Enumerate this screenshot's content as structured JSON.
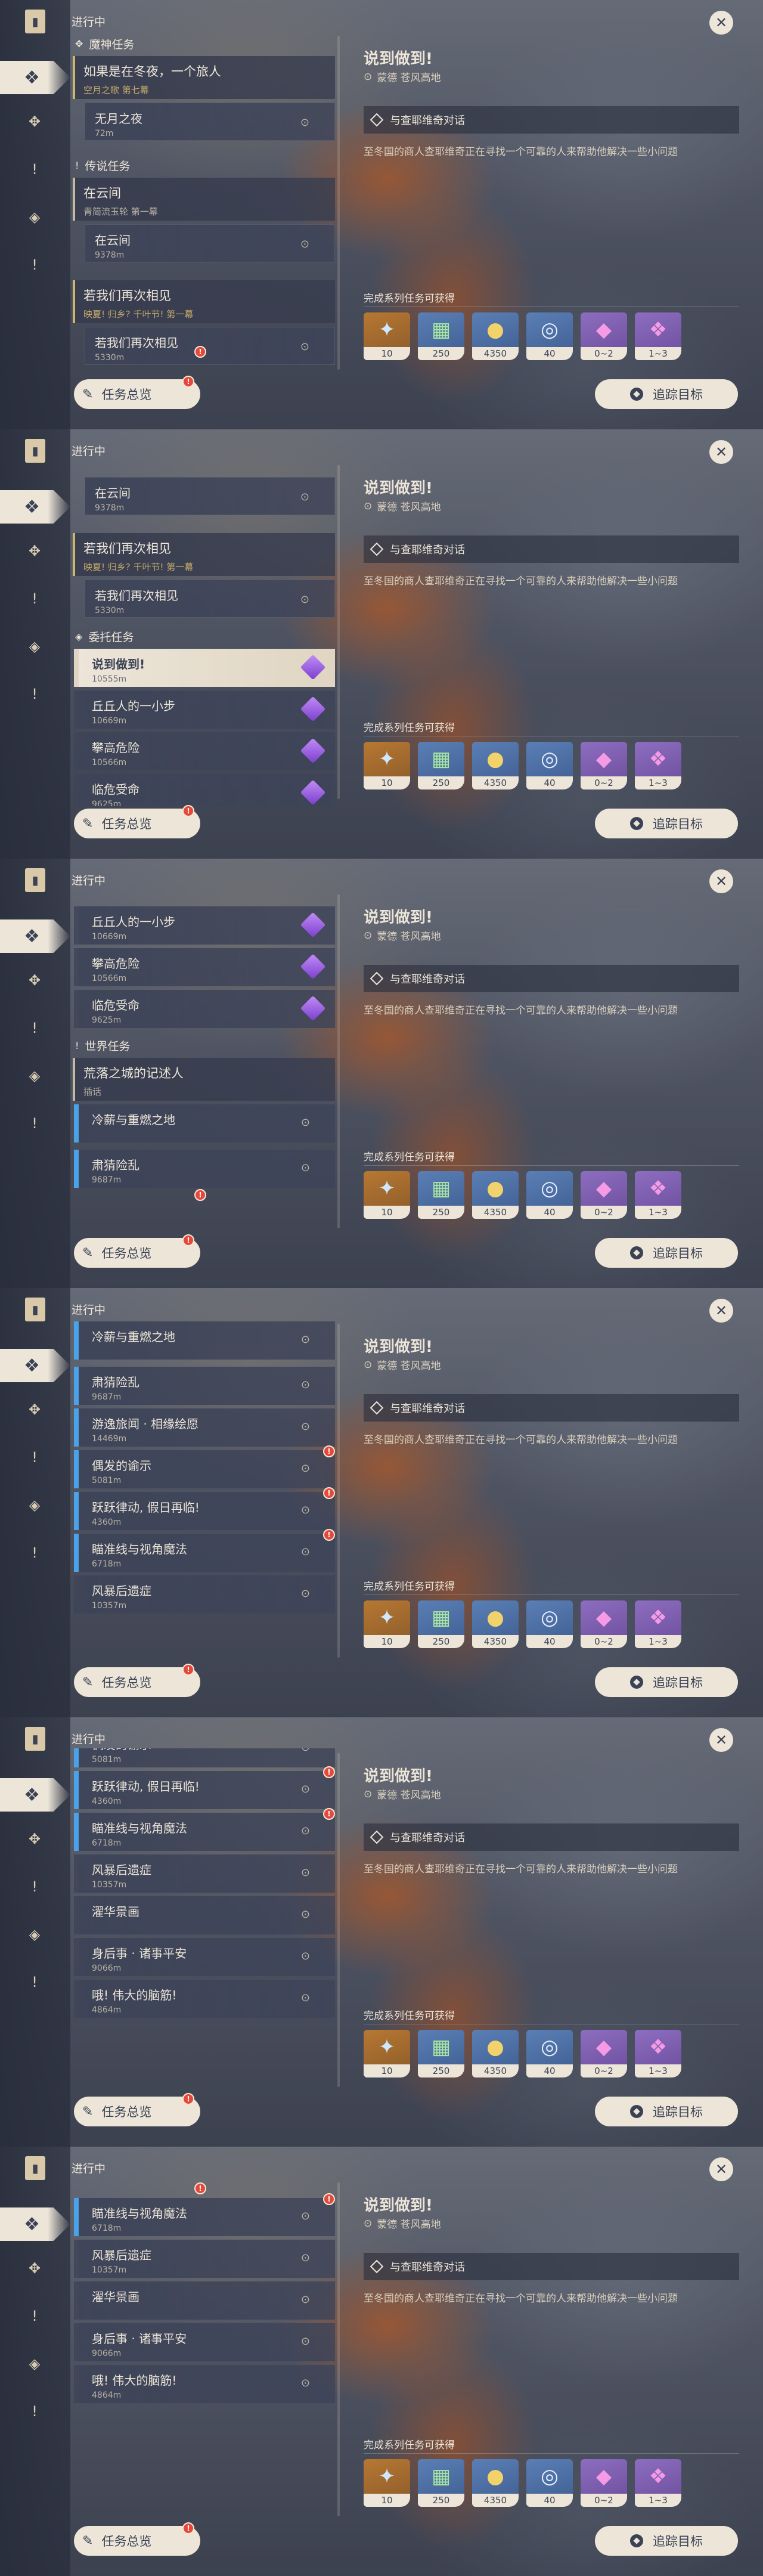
{
  "section_title": "进行中",
  "categories": {
    "archon": "魔神任务",
    "legend": "传说任务",
    "commission": "委托任务",
    "world": "世界任务"
  },
  "quests": {
    "winter_night": {
      "title": "如果是在冬夜，一个旅人",
      "subtitle": "空月之歌 第七幕"
    },
    "no_moon_night": {
      "title": "无月之夜",
      "distance": "72m"
    },
    "yunjian_head": {
      "title": "在云间",
      "subtitle": "青简流玉轮 第一幕"
    },
    "yunjian_step": {
      "title": "在云间",
      "distance": "9378m"
    },
    "meet_again_head": {
      "title": "若我们再次相见",
      "subtitle": "映夏! 归乡? 千叶节! 第一幕"
    },
    "meet_again_step": {
      "title": "若我们再次相见",
      "distance": "5330m"
    },
    "say_do": {
      "title": "说到做到!",
      "distance": "10555m"
    },
    "hill_step": {
      "title": "丘丘人的一小步",
      "distance": "10669m"
    },
    "climb_risk": {
      "title": "攀高危险",
      "distance": "10566m"
    },
    "crisis": {
      "title": "临危受命",
      "distance": "9625m"
    },
    "wasteland_head": {
      "title": "荒落之城的记述人",
      "subtitle": "插话"
    },
    "cold_cinder": {
      "title": "冷薪与重燃之地"
    },
    "clean_chaos": {
      "title": "肃猜险乱",
      "distance": "9687m"
    },
    "drift_portrait": {
      "title": "游逸旅闻 · 相缘绘愿",
      "distance": "14469m"
    },
    "idol_note": {
      "title": "偶发的谕示",
      "distance": "5081m"
    },
    "leap_holiday": {
      "title": "跃跃律动, 假日再临!",
      "distance": "4360m"
    },
    "aim_magic": {
      "title": "瞄准线与视角魔法",
      "distance": "6718m"
    },
    "storm_aftermath": {
      "title": "风暴后遗症",
      "distance": "10357m"
    },
    "shui_scenery": {
      "title": "濯华景画"
    },
    "after_peace": {
      "title": "身后事 · 诸事平安",
      "distance": "9066m"
    },
    "great_brain": {
      "title": "哦! 伟大的脑筋!",
      "distance": "4864m"
    }
  },
  "buttons": {
    "overview": "任务总览",
    "track": "追踪目标"
  },
  "detail": {
    "title": "说到做到!",
    "location": "蒙德 苍风高地",
    "objective": "与查耶维奇对话",
    "description": "至冬国的商人查耶维奇正在寻找一个可靠的人来帮助他解决一些小问题",
    "rewards_title": "完成系列任务可获得",
    "rewards": [
      {
        "icon": "primogem-icon",
        "count": "10"
      },
      {
        "icon": "adventure-exp-icon",
        "count": "250"
      },
      {
        "icon": "mora-icon",
        "count": "4350"
      },
      {
        "icon": "companionship-exp-icon",
        "count": "40"
      },
      {
        "icon": "crystal-small-icon",
        "count": "0~2"
      },
      {
        "icon": "crystal-large-icon",
        "count": "1~3"
      }
    ]
  },
  "colors": {
    "accent_cream": "#ece5d8",
    "ink": "#3b4255",
    "tracking_blue": "#4aa3e8",
    "badge_red": "#e5493d",
    "commission_purple": "#8f55dd"
  }
}
